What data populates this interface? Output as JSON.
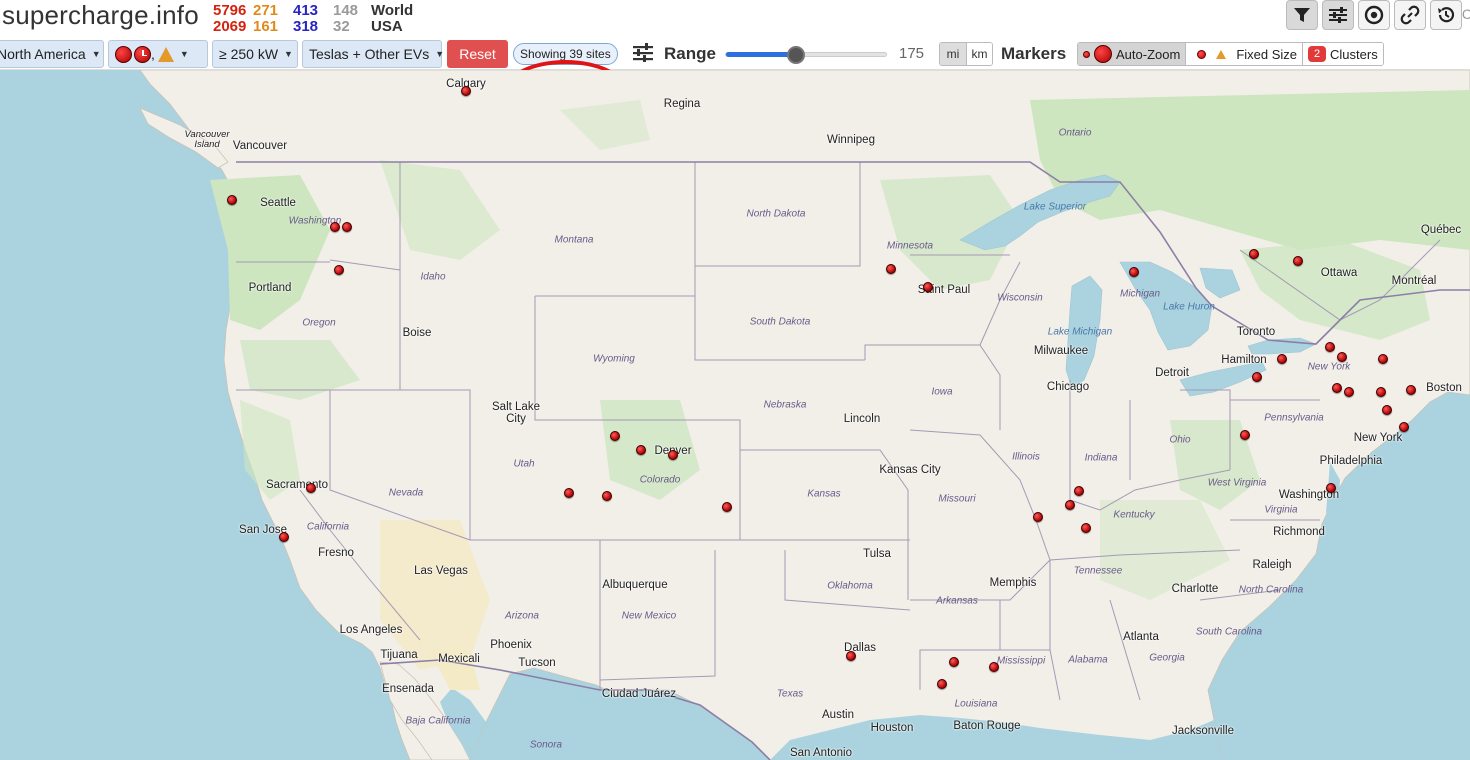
{
  "brand": "supercharge.info",
  "stats": {
    "world": {
      "label": "World",
      "open": "5796",
      "construction": "271",
      "permit": "413",
      "other": "148"
    },
    "usa": {
      "label": "USA",
      "open": "2069",
      "construction": "161",
      "permit": "318",
      "other": "32"
    }
  },
  "toolbar_icons": [
    "filter-icon",
    "settings-sliders-icon",
    "target-icon",
    "link-icon",
    "history-icon"
  ],
  "filters": {
    "region": "North America",
    "status_icons": ",",
    "power": "≥ 250 kW",
    "vehicles": "Teslas + Other EVs",
    "reset_label": "Reset",
    "showing": "Showing 39 sites"
  },
  "range": {
    "label": "Range",
    "value": "175",
    "slider_fraction": 0.44,
    "units": [
      "mi",
      "km"
    ],
    "selected_unit": "mi"
  },
  "markers": {
    "label": "Markers",
    "options": [
      "Auto-Zoom",
      "Fixed Size",
      "Clusters"
    ],
    "selected": "Auto-Zoom",
    "cluster_badge": "2"
  },
  "map": {
    "cities": {
      "calgary": "Calgary",
      "regina": "Regina",
      "winnipeg": "Winnipeg",
      "vancouver_island": "Vancouver Island",
      "vancouver": "Vancouver",
      "seattle": "Seattle",
      "portland": "Portland",
      "boise": "Boise",
      "salt_lake_city": "Salt Lake City",
      "sacramento": "Sacramento",
      "san_jose": "San Jose",
      "fresno": "Fresno",
      "las_vegas": "Las Vegas",
      "los_angeles": "Los Angeles",
      "tijuana": "Tijuana",
      "mexicali": "Mexicali",
      "ensenada": "Ensenada",
      "phoenix": "Phoenix",
      "tucson": "Tucson",
      "albuquerque": "Albuquerque",
      "ciudad_juarez": "Ciudad Juárez",
      "denver": "Denver",
      "lincoln": "Lincoln",
      "kansas_city": "Kansas City",
      "tulsa": "Tulsa",
      "dallas": "Dallas",
      "austin": "Austin",
      "houston": "Houston",
      "san_antonio": "San Antonio",
      "saint_paul": "Saint Paul",
      "milwaukee": "Milwaukee",
      "chicago": "Chicago",
      "memphis": "Memphis",
      "baton_rouge": "Baton Rouge",
      "atlanta": "Atlanta",
      "jacksonville": "Jacksonville",
      "charlotte": "Charlotte",
      "raleigh": "Raleigh",
      "richmond": "Richmond",
      "washington": "Washington",
      "philadelphia": "Philadelphia",
      "new_york": "New York",
      "boston": "Boston",
      "detroit": "Detroit",
      "hamilton": "Hamilton",
      "toronto": "Toronto",
      "ottawa": "Ottawa",
      "montreal": "Montréal",
      "quebec": "Québec"
    },
    "states": {
      "washington": "Washington",
      "oregon": "Oregon",
      "idaho": "Idaho",
      "montana": "Montana",
      "wyoming": "Wyoming",
      "nevada": "Nevada",
      "california": "California",
      "utah": "Utah",
      "colorado": "Colorado",
      "arizona": "Arizona",
      "new_mexico": "New Mexico",
      "north_dakota": "North Dakota",
      "south_dakota": "South Dakota",
      "nebraska": "Nebraska",
      "kansas": "Kansas",
      "oklahoma": "Oklahoma",
      "texas": "Texas",
      "minnesota": "Minnesota",
      "iowa": "Iowa",
      "missouri": "Missouri",
      "arkansas": "Arkansas",
      "louisiana": "Louisiana",
      "wisconsin": "Wisconsin",
      "illinois": "Illinois",
      "michigan": "Michigan",
      "indiana": "Indiana",
      "ohio": "Ohio",
      "kentucky": "Kentucky",
      "tennessee": "Tennessee",
      "mississippi": "Mississippi",
      "alabama": "Alabama",
      "georgia": "Georgia",
      "south_carolina": "South Carolina",
      "north_carolina": "North Carolina",
      "virginia": "Virginia",
      "west_virginia": "West Virginia",
      "pennsylvania": "Pennsylvania",
      "new_york": "New York",
      "ontario": "Ontario",
      "baja_california": "Baja California",
      "sonora": "Sonora"
    },
    "water": {
      "lake_superior": "Lake Superior",
      "lake_michigan": "Lake Michigan",
      "lake_huron": "Lake Huron"
    },
    "site_count": 39
  },
  "colors": {
    "open": "#d4220f",
    "construction": "#e08a1c",
    "permit": "#2a23c4",
    "other": "#9a9a9a",
    "reset": "#e05050",
    "annotation": "#e01414"
  }
}
